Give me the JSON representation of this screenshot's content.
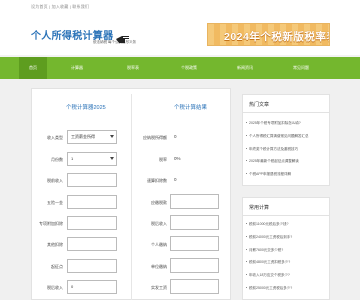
{
  "topbar": {
    "links": "设为首页 | 加入收藏 | 联系我们"
  },
  "header": {
    "logo": "个人所得税计算器",
    "slogan": "依法纳税 每个公民应尽义务",
    "banner": "2024年个税新版税率表"
  },
  "nav": {
    "items": [
      "首页",
      "计算器",
      "税率表",
      "个税政策",
      "新闻资讯",
      "常见问题"
    ]
  },
  "calc": {
    "left_title": "个税计算器2025",
    "right_title": "个税计算结果",
    "fields": [
      {
        "label": "收入类型",
        "value": "工资薪金所得",
        "type": "select"
      },
      {
        "label": "月份数",
        "value": "1",
        "type": "select"
      },
      {
        "label": "税前收入",
        "value": "",
        "type": "input"
      },
      {
        "label": "五险一金",
        "value": "",
        "type": "input"
      },
      {
        "label": "专项附加扣除",
        "value": "",
        "type": "input"
      },
      {
        "label": "其他扣除",
        "value": "",
        "type": "input"
      },
      {
        "label": "起征点",
        "value": "",
        "type": "input"
      },
      {
        "label": "税后收入",
        "value": "0",
        "type": "input"
      }
    ],
    "results": [
      {
        "label": "应纳税所得额",
        "value": "0"
      },
      {
        "label": "税率",
        "value": "0%"
      },
      {
        "label": "速算扣除数",
        "value": "0"
      },
      {
        "label": "应缴税款",
        "value": ""
      },
      {
        "label": "税后收入",
        "value": ""
      },
      {
        "label": "个人缴纳",
        "value": ""
      },
      {
        "label": "单位缴纳",
        "value": ""
      },
      {
        "label": "实发工资",
        "value": ""
      }
    ]
  },
  "sidebar": {
    "box1": {
      "title": "热门文章",
      "items": [
        "2025年个税专项附加扣除怎么填?",
        "个人所得税汇算清缴常见问题解答汇总",
        "年终奖个税计算方法及避税技巧",
        "2025年最新个税起征点调整解读",
        "个税APP申报退税流程详解"
      ]
    },
    "box2": {
      "title": "常用计算",
      "items": [
        "税前11000元税后多少钱?",
        "税前24000元工资税后到手?",
        "月薪7600元交多少税?",
        "税前4800元工资扣税多少?",
        "年收入18万应交个税多少?",
        "税前25000元工资税后多少?"
      ]
    }
  }
}
